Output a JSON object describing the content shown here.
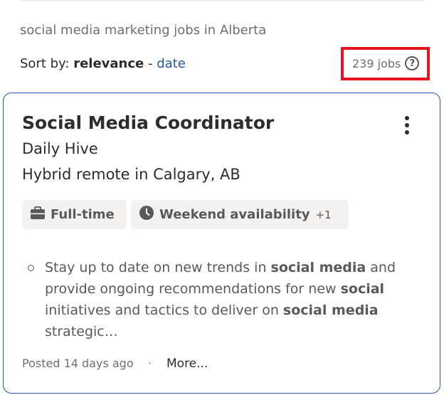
{
  "search": {
    "query_text": "social media marketing jobs in Alberta",
    "sort_label": "Sort by:",
    "sort_relevance": "relevance",
    "sort_separator": " - ",
    "sort_date": "date",
    "job_count": "239 jobs",
    "help_symbol": "?"
  },
  "job": {
    "title": "Social Media Coordinator",
    "company": "Daily Hive",
    "location": "Hybrid remote in Calgary, AB",
    "tags": [
      {
        "icon": "briefcase-icon",
        "label": "Full-time",
        "extra": ""
      },
      {
        "icon": "clock-icon",
        "label": "Weekend availability",
        "extra": "+1"
      }
    ],
    "snippet": {
      "part1": "Stay up to date on new trends in ",
      "bold1": "social media",
      "part2": " and provide ongoing recommendations for new ",
      "bold2": "social",
      "part3": " initiatives and tactics to deliver on ",
      "bold3": "social media",
      "part4": " strategic…"
    },
    "posted": "Posted 14 days ago",
    "separator": "·",
    "more_label": "More..."
  },
  "colors": {
    "link": "#2557a7",
    "highlight_box": "#e8141d",
    "tag_bg": "#f3f2f1"
  }
}
